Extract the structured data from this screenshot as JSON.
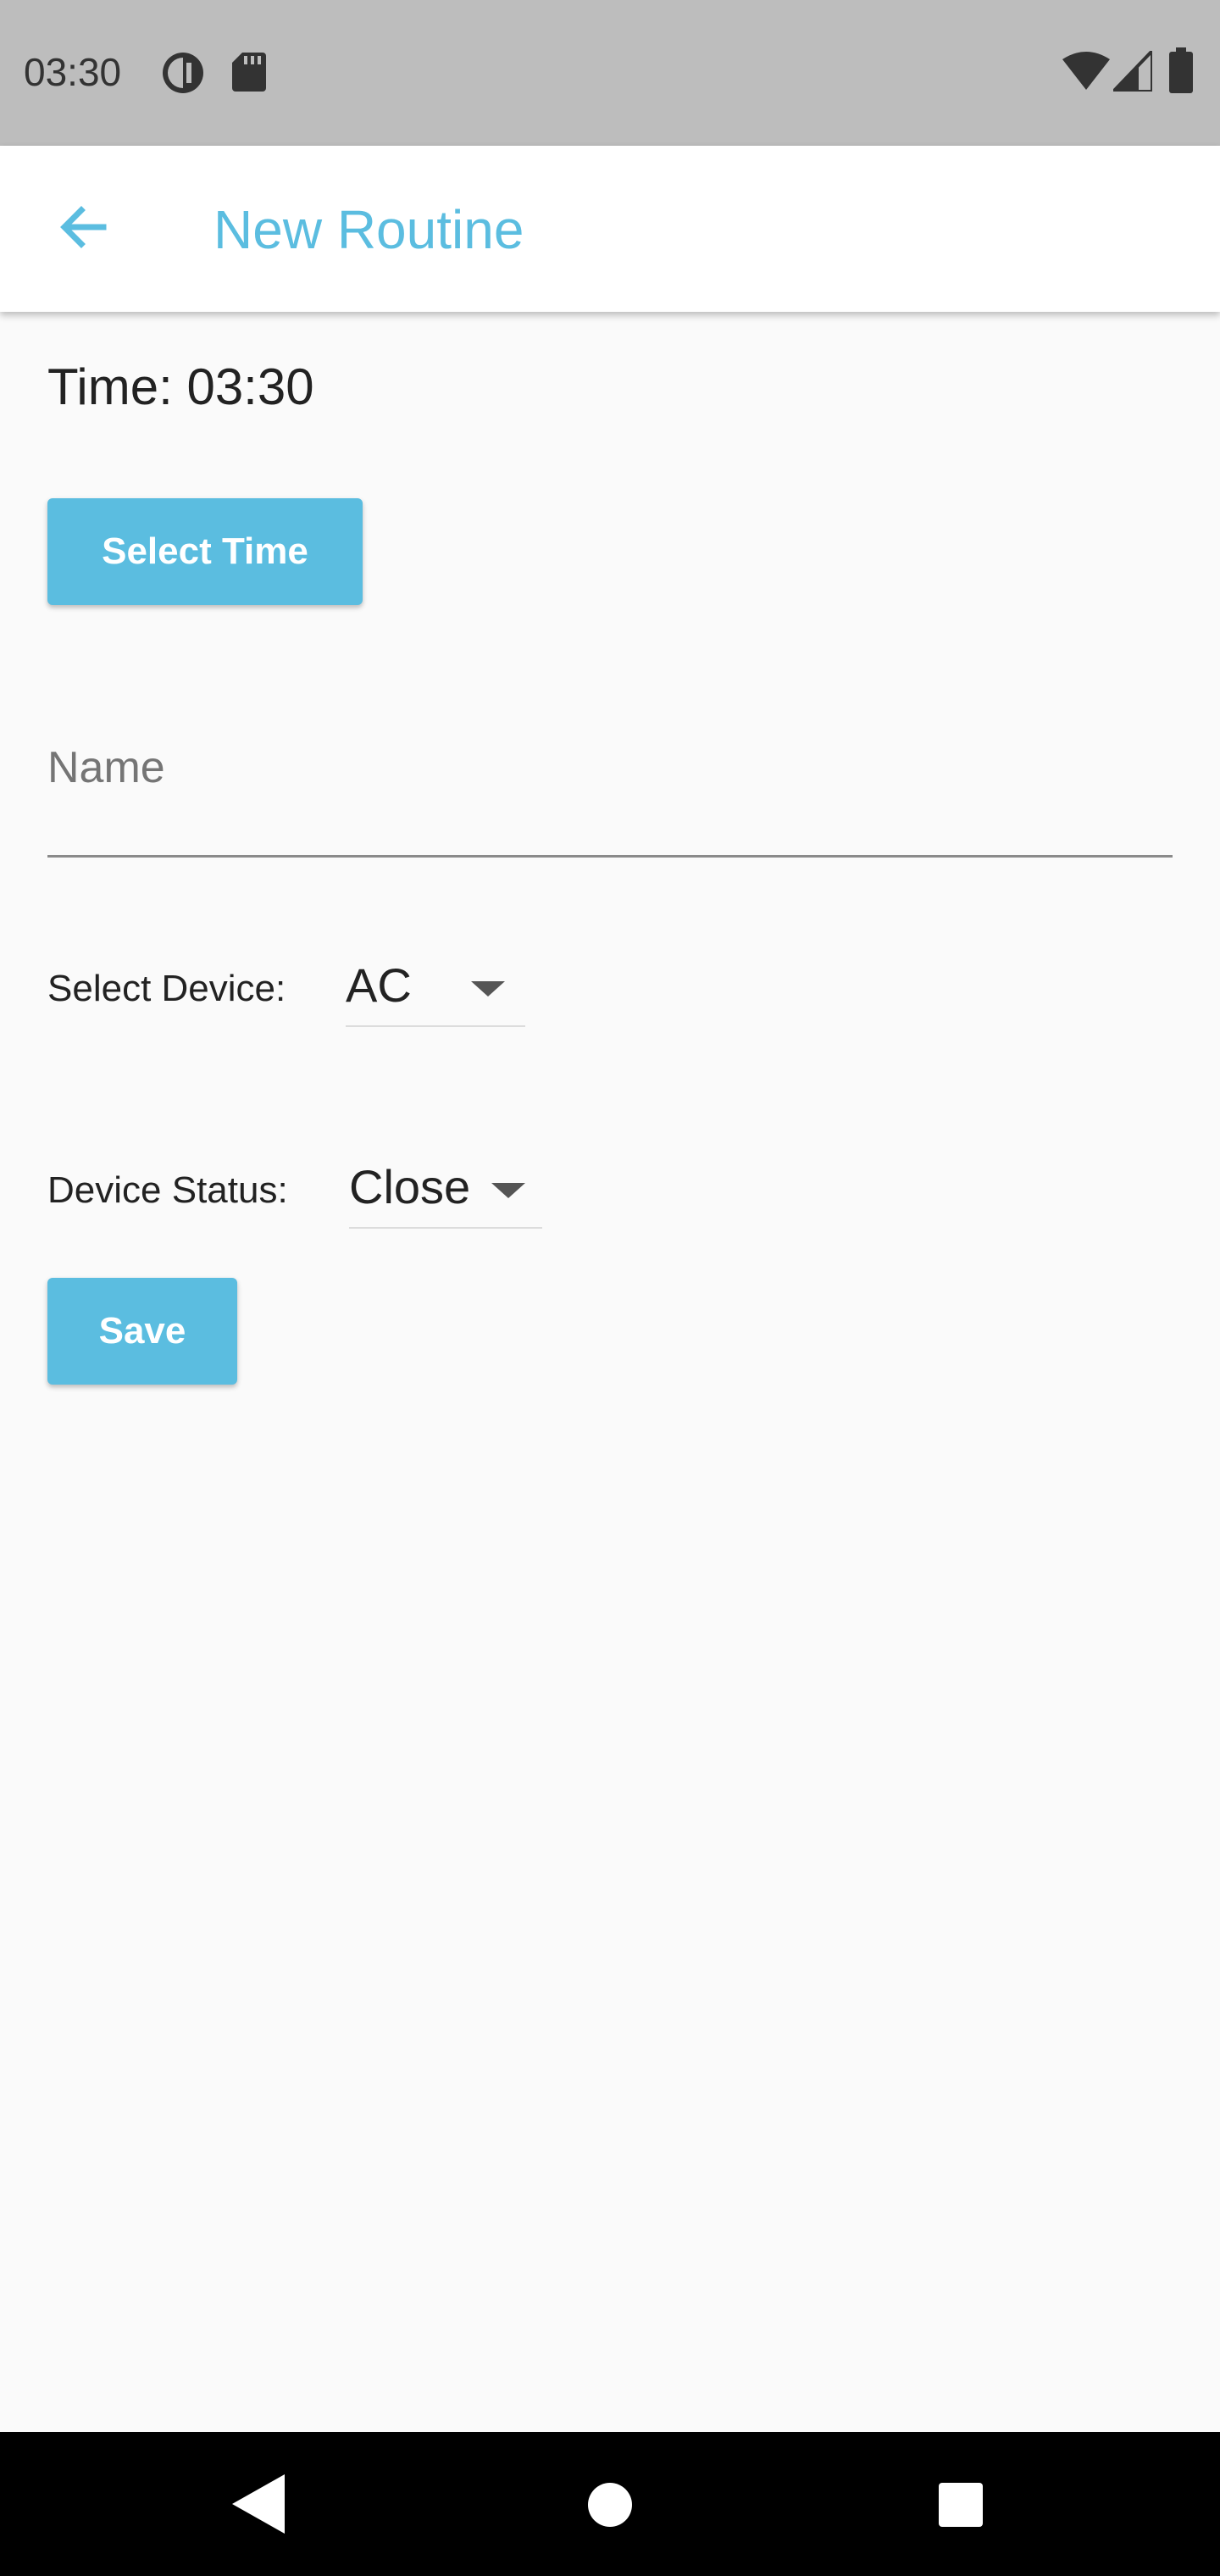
{
  "status_bar": {
    "time": "03:30",
    "icons_left": [
      "data-saver-icon",
      "sd-card-icon"
    ],
    "icons_right": [
      "wifi-icon",
      "cellular-signal-icon",
      "battery-icon"
    ]
  },
  "app_bar": {
    "back_icon": "arrow-back-icon",
    "title": "New Routine"
  },
  "form": {
    "time_label": "Time: 03:30",
    "select_time_button": "Select Time",
    "name_placeholder": "Name",
    "name_value": "",
    "device_label": "Select Device:",
    "device_value": "AC",
    "status_label": "Device Status:",
    "status_value": "Close",
    "save_button": "Save"
  },
  "nav_bar": {
    "icons": [
      "nav-back-icon",
      "nav-home-icon",
      "nav-recents-icon"
    ]
  },
  "colors": {
    "accent": "#5bbde0",
    "status_bar_bg": "#bdbdbd",
    "background": "#fafafa"
  }
}
